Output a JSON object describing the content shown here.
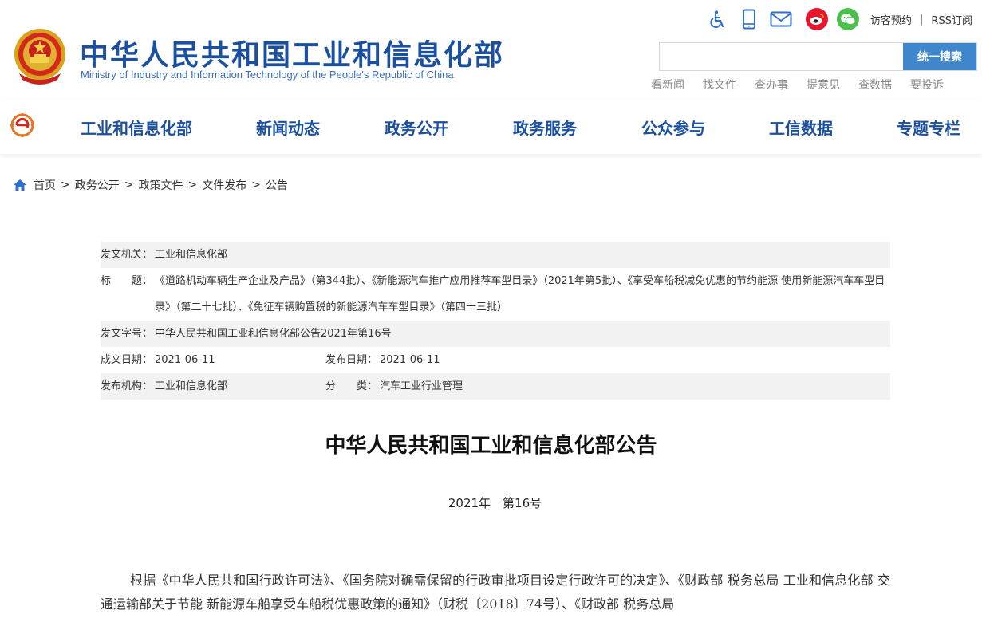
{
  "header": {
    "title": "中华人民共和国工业和信息化部",
    "subtitle": "Ministry of Industry and Information Technology of the People's Republic of China",
    "utility_icons": [
      "accessibility-icon",
      "mobile-icon",
      "mail-icon",
      "weibo-icon",
      "wechat-icon"
    ],
    "visitor_link": "访客预约",
    "separator": "|",
    "rss_link": "RSS订阅",
    "search": {
      "placeholder": "",
      "button_label": "统一搜索"
    },
    "quick_links": [
      "看新闻",
      "找文件",
      "查办事",
      "提意见",
      "查数据",
      "要投诉"
    ]
  },
  "nav": {
    "items": [
      "工业和信息化部",
      "新闻动态",
      "政务公开",
      "政务服务",
      "公众参与",
      "工信数据",
      "专题专栏"
    ]
  },
  "breadcrumb": {
    "items": [
      "首页",
      "政务公开",
      "政策文件",
      "文件发布",
      "公告"
    ],
    "separator": ">"
  },
  "meta": {
    "issuer_label": "发文机关：",
    "issuer": "工业和信息化部",
    "title_label": "标　　题：",
    "title": "《道路机动车辆生产企业及产品》（第344批）、《新能源汽车推广应用推荐车型目录》（2021年第5批）、《享受车船税减免优惠的节约能源 使用新能源汽车车型目录》（第二十七批）、《免征车辆购置税的新能源汽车车型目录》（第四十三批）",
    "doc_no_label": "发文字号：",
    "doc_no": "中华人民共和国工业和信息化部公告2021年第16号",
    "written_date_label": "成文日期：",
    "written_date": "2021-06-11",
    "publish_date_label": "发布日期：",
    "publish_date": "2021-06-11",
    "publisher_label": "发布机构：",
    "publisher": "工业和信息化部",
    "category_label": "分　　类：",
    "category": "汽车工业行业管理"
  },
  "article": {
    "title": "中华人民共和国工业和信息化部公告",
    "number": "2021年　第16号",
    "body": "根据《中华人民共和国行政许可法》、《国务院对确需保留的行政审批项目设定行政许可的决定》、《财政部 税务总局 工业和信息化部 交通运输部关于节能 新能源车船享受车船税优惠政策的通知》（财税〔2018〕74号）、《财政部 税务总局"
  },
  "colors": {
    "brand_blue": "#1b4fa0",
    "search_button": "#3f86cd",
    "meta_shade": "#f2f2f2",
    "weibo": "#e6162d",
    "wechat": "#4cbf4c"
  }
}
